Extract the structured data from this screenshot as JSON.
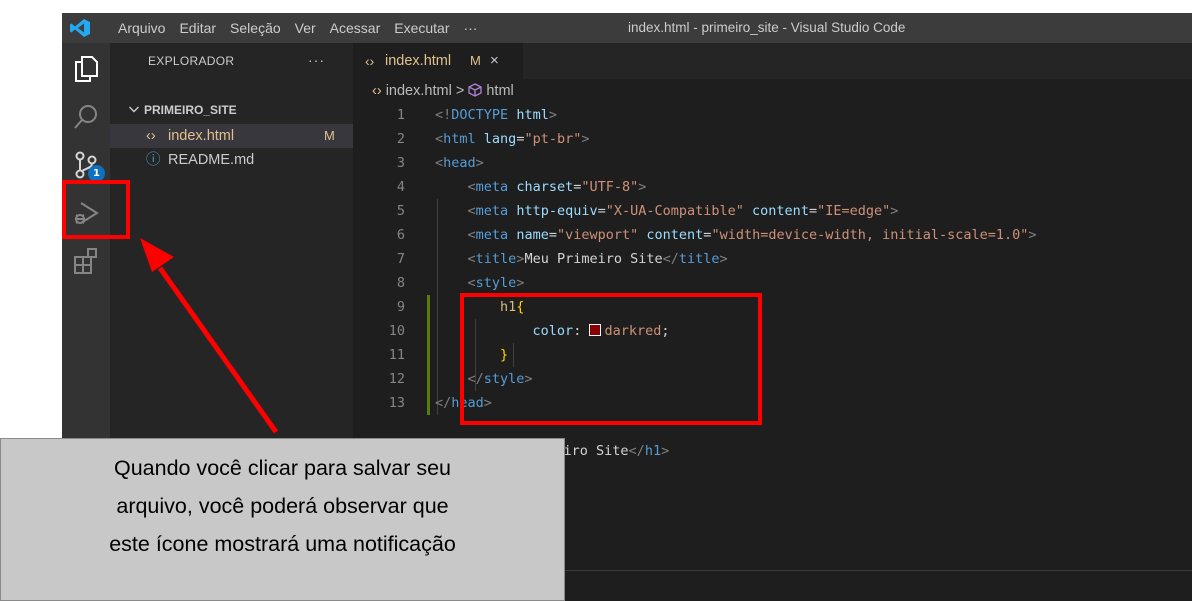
{
  "window": {
    "title": "index.html - primeiro_site - Visual Studio Code",
    "logo_icon": "vscode-logo-icon"
  },
  "menu": [
    "Arquivo",
    "Editar",
    "Seleção",
    "Ver",
    "Acessar",
    "Executar",
    "···"
  ],
  "activity_bar": {
    "icons": [
      "explorer-icon",
      "search-icon",
      "source-control-icon",
      "run-debug-icon",
      "extensions-icon"
    ],
    "source_control_badge": "1"
  },
  "sidebar": {
    "header": "EXPLORADOR",
    "more_actions": "···",
    "folder": "PRIMEIRO_SITE",
    "files": [
      {
        "name": "index.html",
        "icon": "‹›",
        "status": "M"
      },
      {
        "name": "README.md",
        "icon": "ⓘ",
        "status": ""
      }
    ]
  },
  "editor": {
    "tab": {
      "icon": "‹›",
      "name": "index.html",
      "status": "M",
      "close": "×"
    },
    "breadcrumb": {
      "file": "index.html",
      "separator": ">",
      "symbol": "html"
    },
    "line_numbers": [
      "1",
      "2",
      "3",
      "4",
      "5",
      "6",
      "7",
      "8",
      "9",
      "10",
      "11",
      "12",
      "13",
      "",
      "",
      ""
    ],
    "code_text": {
      "l1_br_open": "<!",
      "l1_kw": "DOCTYPE",
      "l1_tag": "html",
      "l1_br_close": ">",
      "l2_tag": "html",
      "l2_attr": "lang",
      "l2_val": "\"pt-br\"",
      "l3_tag": "head",
      "l4_tag": "meta",
      "l4_attr": "charset",
      "l4_val": "\"UTF-8\"",
      "l5_tag": "meta",
      "l5_attr1": "http-equiv",
      "l5_val1": "\"X-UA-Compatible\"",
      "l5_attr2": "content",
      "l5_val2": "\"IE=edge\"",
      "l6_tag": "meta",
      "l6_attr1": "name",
      "l6_val1": "\"viewport\"",
      "l6_attr2": "content",
      "l6_val2": "\"width=device-width, initial-scale=1.0\"",
      "l7_tag": "title",
      "l7_text": "Meu Primeiro Site",
      "l7_close": "title",
      "l8_tag": "style",
      "l9_selector": "h1",
      "l9_brace": "{",
      "l10_prop": "color",
      "l10_colon": ":",
      "l10_value": "darkred",
      "l10_semicolon": ";",
      "l11_brace": "}",
      "l12_tag": "style",
      "l13_tag": "head",
      "l15_text": "rimeiro Site",
      "l15_tag": "h1"
    },
    "swatch_color": "#8b0000"
  },
  "annotation": {
    "caption_lines": [
      "Quando você clicar para salvar seu",
      "arquivo, você poderá observar que",
      "este ícone mostrará uma notificação"
    ],
    "highlight_color": "#ff0000"
  }
}
